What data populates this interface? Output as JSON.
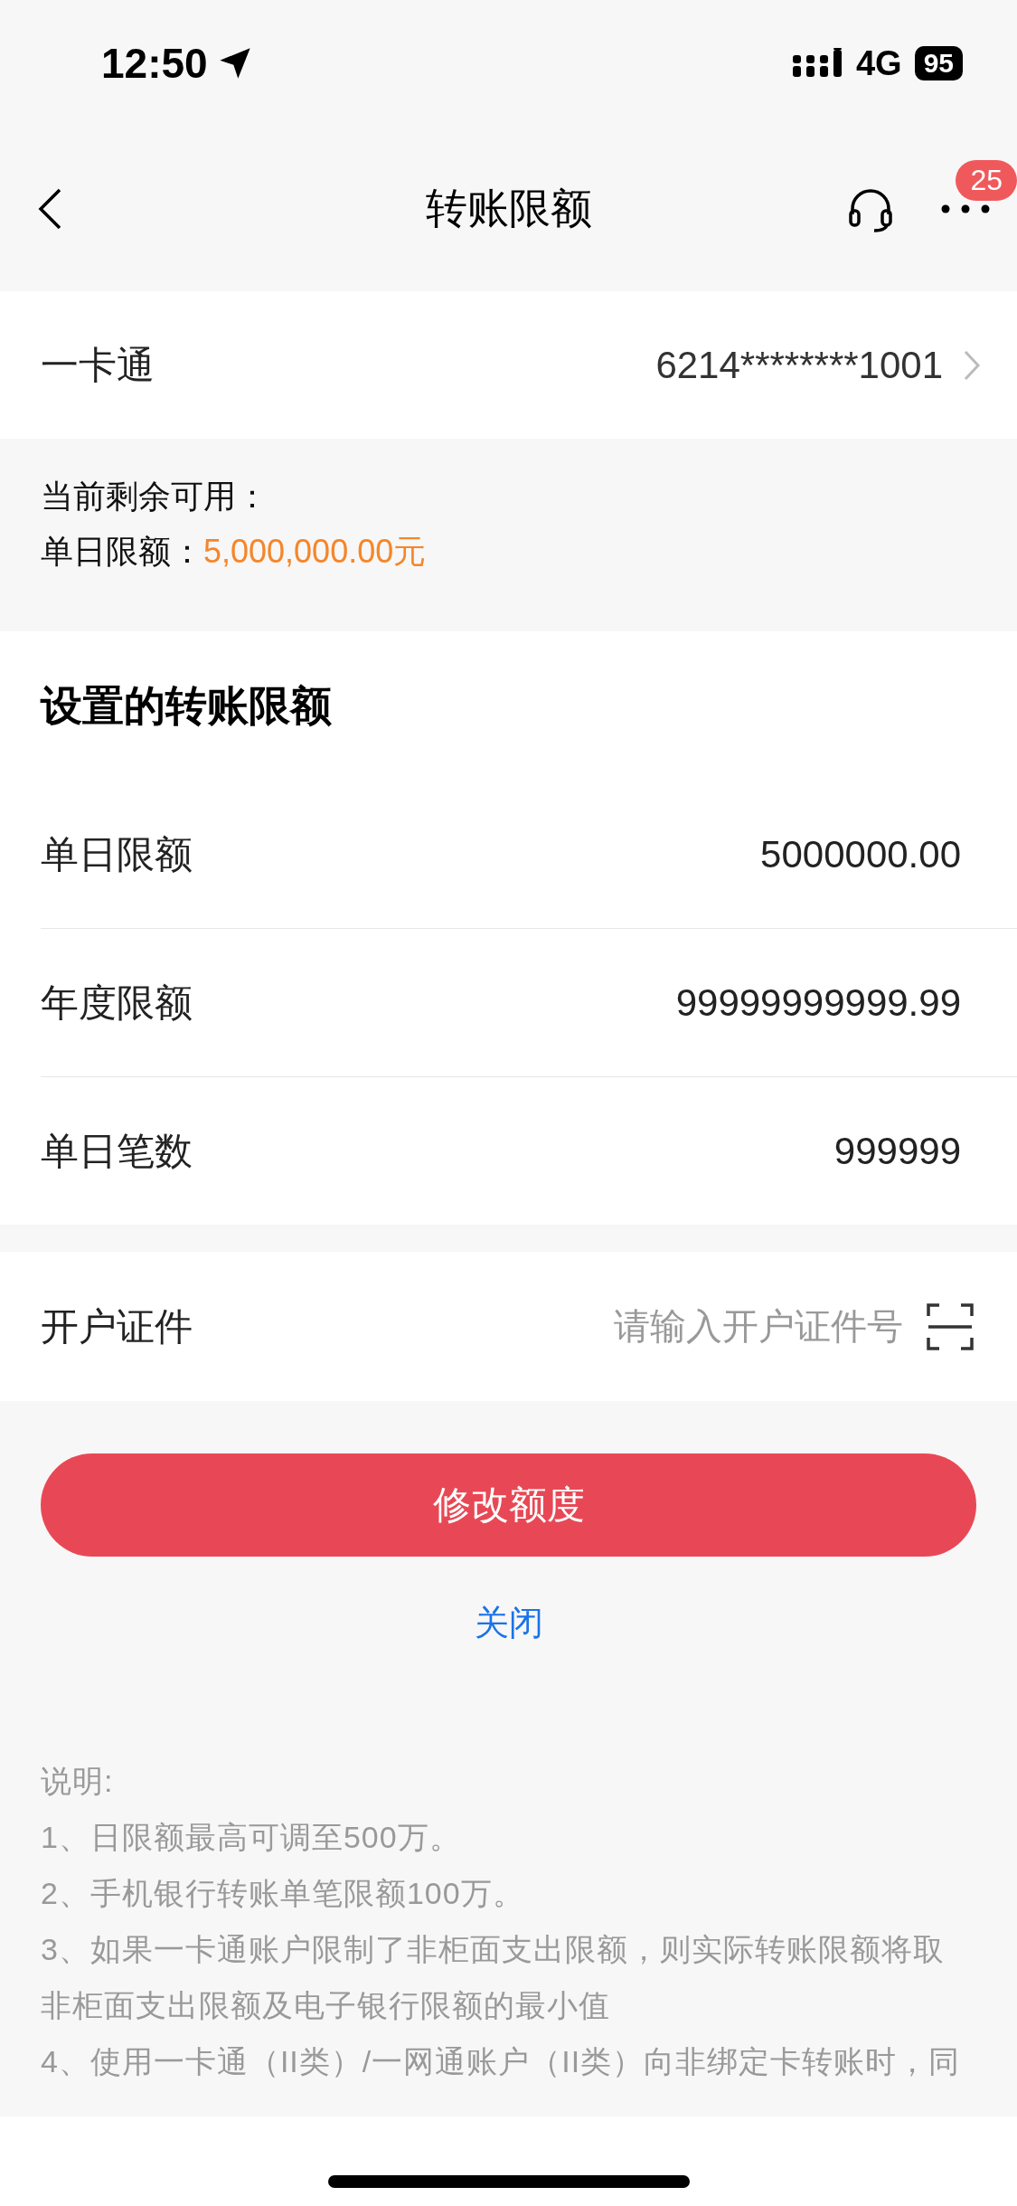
{
  "status_bar": {
    "time": "12:50",
    "network": "4G",
    "battery": "95"
  },
  "nav": {
    "title": "转账限额",
    "badge": "25"
  },
  "account": {
    "label": "一卡通",
    "value": "6214********1001"
  },
  "available": {
    "caption": "当前剩余可用：",
    "label": "单日限额：",
    "amount": "5,000,000.00元"
  },
  "limits": {
    "heading": "设置的转账限额",
    "rows": [
      {
        "label": "单日限额",
        "value": "5000000.00"
      },
      {
        "label": "年度限额",
        "value": "99999999999.99"
      },
      {
        "label": "单日笔数",
        "value": "999999"
      }
    ]
  },
  "id_field": {
    "label": "开户证件",
    "placeholder": "请输入开户证件号"
  },
  "submit_button": "修改额度",
  "close_link": "关闭",
  "notes": {
    "title": "说明:",
    "items": [
      "1、日限额最高可调至500万。",
      "2、手机银行转账单笔限额100万。",
      "3、如果一卡通账户限制了非柜面支出限额，则实际转账限额将取非柜面支出限额及电子银行限额的最小值",
      "4、使用一卡通（II类）/一网通账户（II类）向非绑定卡转账时，同"
    ]
  }
}
